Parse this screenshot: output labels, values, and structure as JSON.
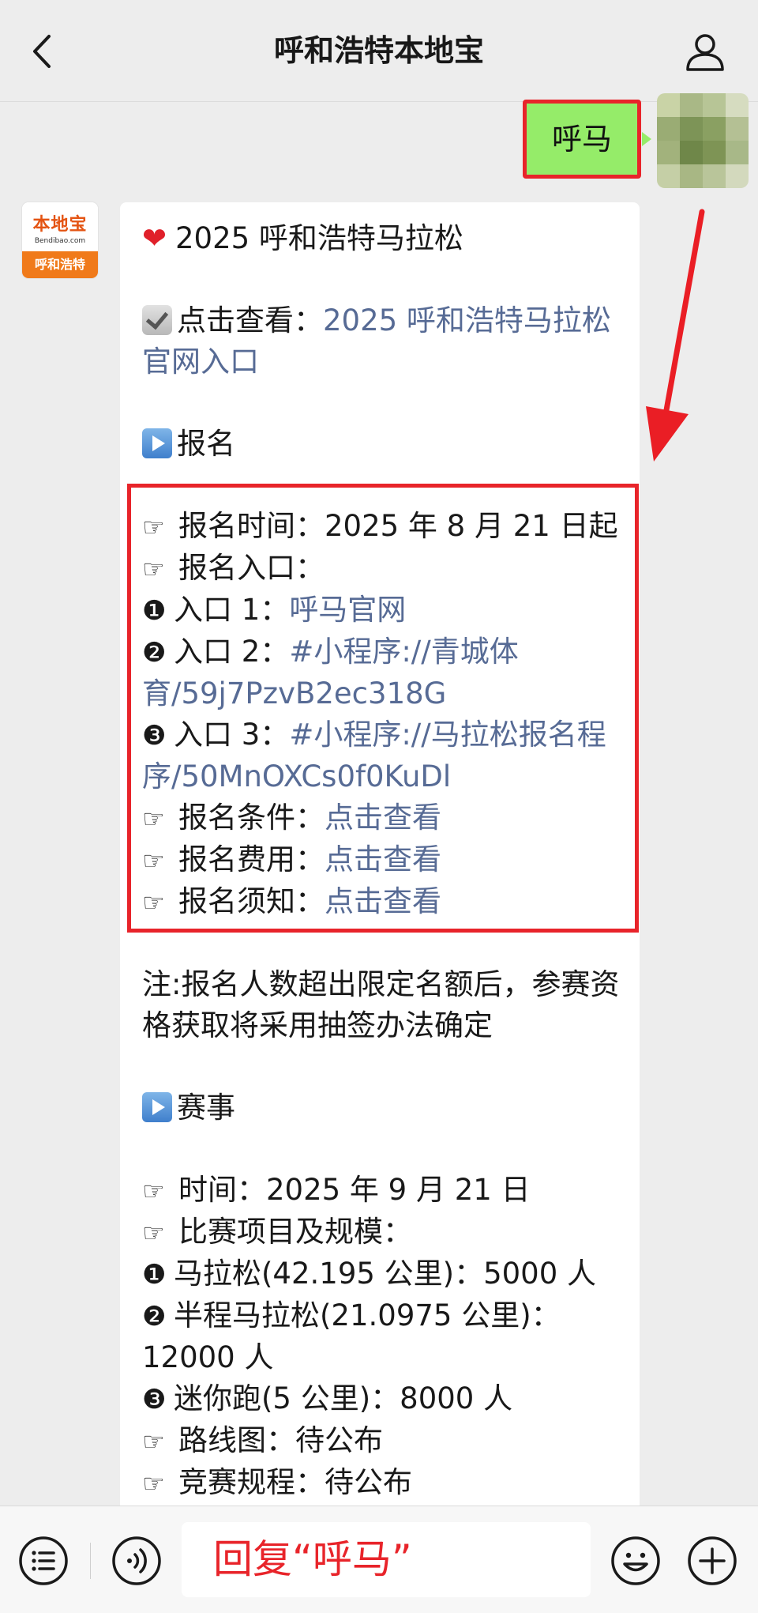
{
  "header": {
    "title": "呼和浩特本地宝",
    "back_icon": "chevron-left-icon",
    "profile_icon": "person-icon"
  },
  "user_message": {
    "text": "呼马"
  },
  "account_avatar": {
    "brand": "本地宝",
    "domain": "Bendibao.com",
    "city": "呼和浩特"
  },
  "reply": {
    "title": {
      "emoji": "❤️",
      "text": "2025 呼和浩特马拉松"
    },
    "official": {
      "label": "点击查看：",
      "link_text": "2025 呼和浩特马拉松官网入口"
    },
    "section_registration": "报名",
    "registration": {
      "time_label": "报名时间：",
      "time_value": "2025 年 8 月 21 日起",
      "entry_label": "报名入口：",
      "entry1_num": "❶",
      "entry1_label": "入口 1：",
      "entry1_link": "呼马官网",
      "entry2_num": "❷",
      "entry2_label": "入口 2：",
      "entry2_link": "#小程序://青城体育/59j7PzvB2ec318G",
      "entry3_num": "❸",
      "entry3_label": "入口 3：",
      "entry3_link": "#小程序://马拉松报名程序/50MnOXCs0f0KuDl",
      "conditions_label": "报名条件：",
      "fees_label": "报名费用：",
      "notice_label": "报名须知：",
      "view_link": "点击查看"
    },
    "note": "注:报名人数超出限定名额后，参赛资格获取将采用抽签办法确定",
    "section_event": "赛事",
    "event": {
      "time_label": "时间：",
      "time_value": "2025 年 9 月 21 日",
      "items_label": "比赛项目及规模：",
      "item1_num": "❶",
      "item1_text": "马拉松(42.195 公里)：5000 人",
      "item2_num": "❷",
      "item2_text": "半程马拉松(21.0975 公里)：12000 人",
      "item3_num": "❸",
      "item3_text": "迷你跑(5 公里)：8000 人",
      "route_label": "路线图：",
      "route_value": "待公布",
      "rules_label": "竞赛规程：",
      "rules_value": "待公布"
    },
    "hand_icon": "☞"
  },
  "input_bar": {
    "text": "回复“呼马”",
    "menu_icon": "list-icon",
    "voice_icon": "voice-icon",
    "emoji_icon": "smiley-icon",
    "plus_icon": "plus-icon"
  },
  "colors": {
    "link": "#576b95",
    "highlight_red": "#e8242a",
    "user_bubble": "#95ec69",
    "background": "#ededed"
  }
}
